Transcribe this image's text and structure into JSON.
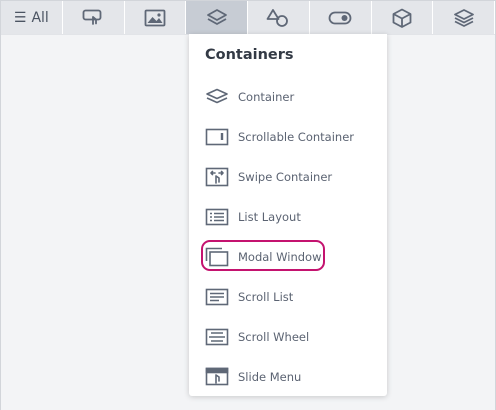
{
  "toolbar": {
    "all_label": "All",
    "tabs": [
      {
        "icon": "touch-icon"
      },
      {
        "icon": "image-icon"
      },
      {
        "icon": "layers-icon",
        "active": true
      },
      {
        "icon": "shapes-icon"
      },
      {
        "icon": "toggle-icon"
      },
      {
        "icon": "cube-icon"
      },
      {
        "icon": "stack-icon"
      }
    ]
  },
  "dropdown": {
    "title": "Containers",
    "items": [
      {
        "label": "Container",
        "icon": "container-icon"
      },
      {
        "label": "Scrollable Container",
        "icon": "scrollable-container-icon"
      },
      {
        "label": "Swipe Container",
        "icon": "swipe-container-icon"
      },
      {
        "label": "List Layout",
        "icon": "list-layout-icon"
      },
      {
        "label": "Modal Window",
        "icon": "modal-window-icon",
        "highlighted": true
      },
      {
        "label": "Scroll List",
        "icon": "scroll-list-icon"
      },
      {
        "label": "Scroll Wheel",
        "icon": "scroll-wheel-icon"
      },
      {
        "label": "Slide Menu",
        "icon": "slide-menu-icon"
      }
    ]
  },
  "colors": {
    "highlight": "#c4136f",
    "tab_bg": "#e4e6ea",
    "tab_active_bg": "#c7ccd4",
    "icon": "#5f6877"
  }
}
